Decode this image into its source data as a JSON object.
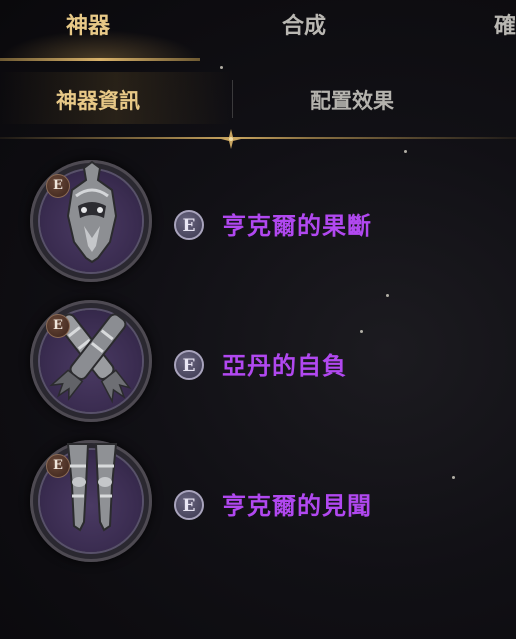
{
  "top_tabs": [
    {
      "label": "神器",
      "active": true
    },
    {
      "label": "合成",
      "active": false
    },
    {
      "label": "確",
      "active": false
    }
  ],
  "sub_tabs": [
    {
      "label": "神器資訊",
      "active": true
    },
    {
      "label": "配置效果",
      "active": false
    }
  ],
  "items": [
    {
      "name": "亨克爾的果斷",
      "grade": "E",
      "icon": "helmet-icon"
    },
    {
      "name": "亞丹的自負",
      "grade": "E",
      "icon": "gauntlets-icon"
    },
    {
      "name": "亨克爾的見聞",
      "grade": "E",
      "icon": "greaves-icon"
    }
  ],
  "colors": {
    "accent_gold": "#e8c987",
    "item_name_purple": "#b148f0",
    "disc_purple": "#3a2c50"
  }
}
